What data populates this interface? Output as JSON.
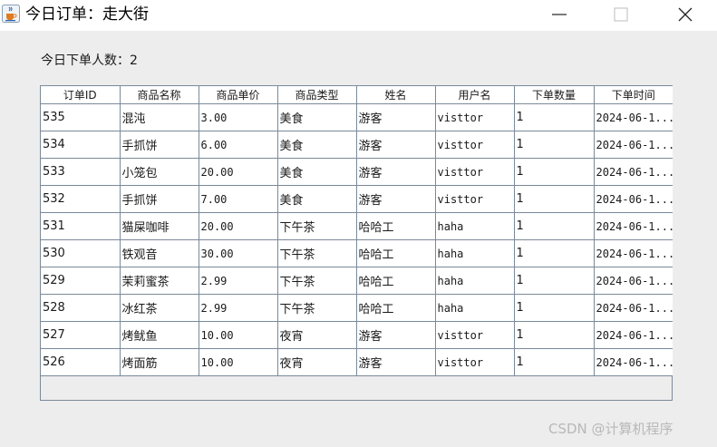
{
  "window": {
    "title": "今日订单：走大街",
    "app_icon": "java-cup-icon"
  },
  "summary": {
    "label": "今日下单人数：",
    "value": "2"
  },
  "table": {
    "columns": [
      "订单ID",
      "商品名称",
      "商品单价",
      "商品类型",
      "姓名",
      "用户名",
      "下单数量",
      "下单时间"
    ],
    "rows": [
      [
        "535",
        "混沌",
        "3.00",
        "美食",
        "游客",
        "visttor",
        "1",
        "2024-06-1..."
      ],
      [
        "534",
        "手抓饼",
        "6.00",
        "美食",
        "游客",
        "visttor",
        "1",
        "2024-06-1..."
      ],
      [
        "533",
        "小笼包",
        "20.00",
        "美食",
        "游客",
        "visttor",
        "1",
        "2024-06-1..."
      ],
      [
        "532",
        "手抓饼",
        "7.00",
        "美食",
        "游客",
        "visttor",
        "1",
        "2024-06-1..."
      ],
      [
        "531",
        "猫屎咖啡",
        "20.00",
        "下午茶",
        "哈哈工",
        "haha",
        "1",
        "2024-06-1..."
      ],
      [
        "530",
        "铁观音",
        "30.00",
        "下午茶",
        "哈哈工",
        "haha",
        "1",
        "2024-06-1..."
      ],
      [
        "529",
        "茉莉蜜茶",
        "2.99",
        "下午茶",
        "哈哈工",
        "haha",
        "1",
        "2024-06-1..."
      ],
      [
        "528",
        "冰红茶",
        "2.99",
        "下午茶",
        "哈哈工",
        "haha",
        "1",
        "2024-06-1..."
      ],
      [
        "527",
        "烤鱿鱼",
        "10.00",
        "夜宵",
        "游客",
        "visttor",
        "1",
        "2024-06-1..."
      ],
      [
        "526",
        "烤面筋",
        "10.00",
        "夜宵",
        "游客",
        "visttor",
        "1",
        "2024-06-1..."
      ]
    ]
  },
  "watermark": "CSDN @计算机程序",
  "colors": {
    "window_background": "#ededed",
    "grid_line": "#7a8a99",
    "cell_background": "#ffffff"
  }
}
